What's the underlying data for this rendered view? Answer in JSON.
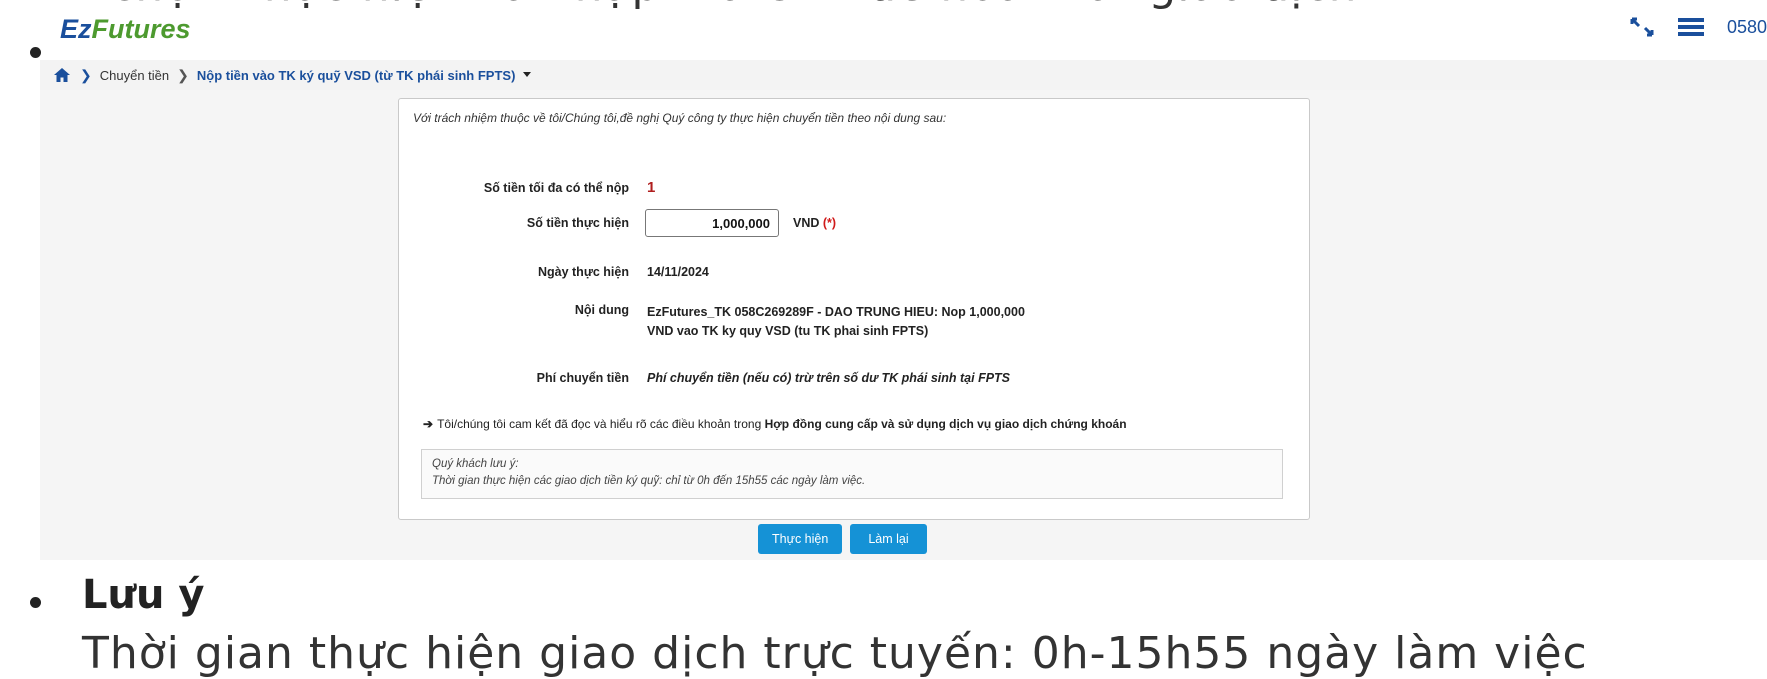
{
  "article": {
    "top_text": "chọn Thực hiện và nhập mã OTP để hoàn tất giao dịch",
    "heading": "Lưu ý",
    "bottom_text": "Thời gian thực hiện giao dịch trực tuyến: 0h-15h55 ngày làm việc"
  },
  "header": {
    "logo_ez": "Ez",
    "logo_futures": "Futures",
    "account": "0580"
  },
  "breadcrumb": {
    "parent": "Chuyển tiền",
    "current": "Nộp tiền vào TK ký quỹ VSD (từ TK phái sinh FPTS)"
  },
  "form": {
    "intro": "Với trách nhiệm thuộc về tôi/Chúng tôi,đề nghị Quý công ty thực hiện chuyển tiền theo nội dung sau:",
    "max_label": "Số tiền tối đa có thể nộp",
    "max_value": "1",
    "amount_label": "Số tiền thực hiện",
    "amount_value": "1,000,000",
    "amount_unit": "VND",
    "amount_required": "(*)",
    "date_label": "Ngày thực hiện",
    "date_value": "14/11/2024",
    "content_label": "Nội dung",
    "content_line1": "EzFutures_TK 058C269289F - DAO TRUNG HIEU: Nop 1,000,000",
    "content_line2": "VND vao TK ky quy VSD (tu TK phai sinh FPTS)",
    "fee_label": "Phí chuyển tiền",
    "fee_value": "Phí chuyển tiền (nếu có) trừ trên số dư TK phái sinh tại FPTS",
    "commit_text": "Tôi/chúng tôi cam kết đã đọc và hiểu rõ các điều khoản trong",
    "commit_bold": "Hợp đồng cung cấp và sử dụng dịch vụ giao dịch chứng khoán",
    "note_title": "Quý khách lưu ý:",
    "note_text": "Thời gian thực hiện các giao dịch tiền ký quỹ: chỉ từ 0h đến 15h55 các ngày làm việc."
  },
  "buttons": {
    "submit": "Thực hiện",
    "reset": "Làm lại"
  },
  "colors": {
    "brand_blue": "#1a4f9c",
    "brand_green": "#4d9a2f",
    "button_blue": "#1592d6",
    "required_red": "#d01a1a"
  }
}
